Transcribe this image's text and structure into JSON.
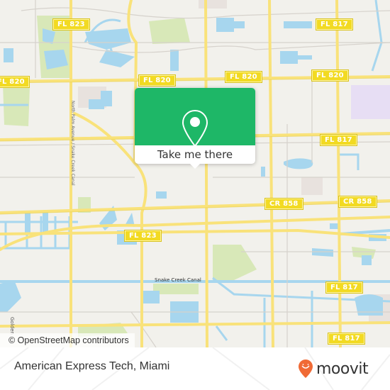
{
  "map": {
    "shields": [
      {
        "label": "FL 823",
        "pos": "top-left"
      },
      {
        "label": "FL 817",
        "pos": "top-right"
      },
      {
        "label": "FL 820",
        "pos": "left-edge"
      },
      {
        "label": "FL 820",
        "pos": "upper-center-left"
      },
      {
        "label": "FL 820",
        "pos": "upper-center"
      },
      {
        "label": "FL 820",
        "pos": "upper-right"
      },
      {
        "label": "FL 817",
        "pos": "right-middle"
      },
      {
        "label": "CR 858",
        "pos": "center-right"
      },
      {
        "label": "CR 858",
        "pos": "right"
      },
      {
        "label": "FL 823",
        "pos": "center"
      },
      {
        "label": "FL 817",
        "pos": "lower-right"
      },
      {
        "label": "FL 817",
        "pos": "bottom-right"
      }
    ],
    "labels": {
      "canal": "Snake Creek Canal",
      "road_vertical": "North Palm Avenue / Snake Creek Canal",
      "golden": "Golden"
    },
    "attribution": "© OpenStreetMap contributors"
  },
  "popup": {
    "icon": "map-pin-icon",
    "cta_label": "Take me there",
    "accent_color": "#1eb767"
  },
  "footer": {
    "place_name": "American Express Tech, Miami",
    "brand": "moovit",
    "brand_color": "#f06a35"
  }
}
